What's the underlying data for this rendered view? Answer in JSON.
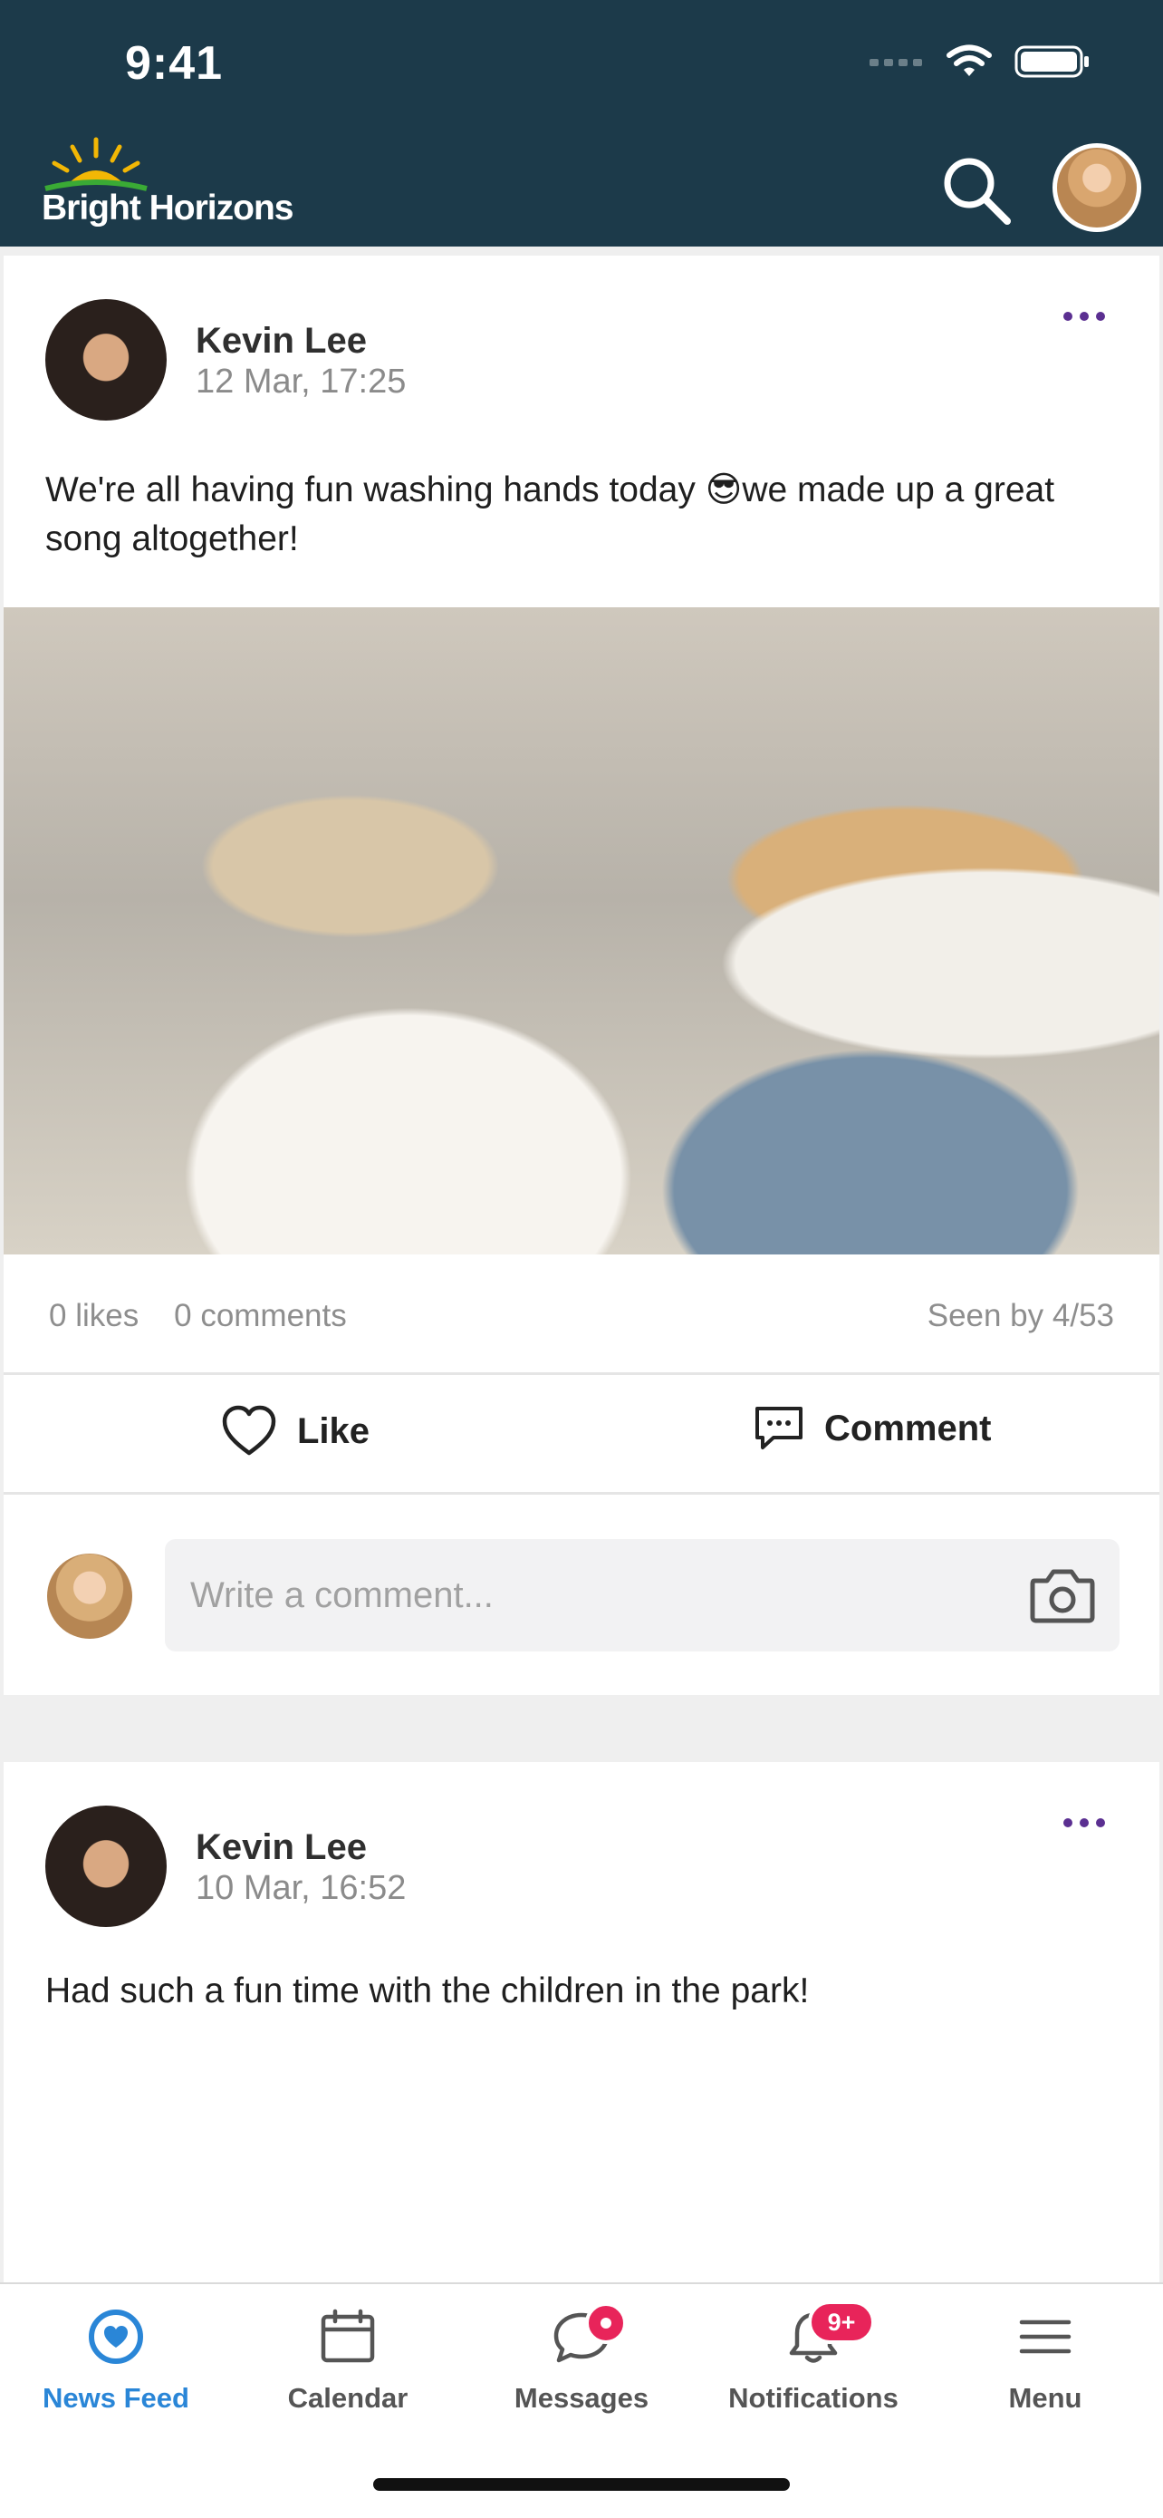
{
  "status": {
    "time": "9:41"
  },
  "brand": {
    "name": "Bright Horizons"
  },
  "posts": [
    {
      "author": "Kevin Lee",
      "time": "12 Mar, 17:25",
      "text": "We're all having fun washing hands today 😎we made up a great song altogether!",
      "likes": "0 likes",
      "comments": "0 comments",
      "seen": "Seen by 4/53",
      "like_label": "Like",
      "comment_label": "Comment",
      "comment_placeholder": "Write a comment..."
    },
    {
      "author": "Kevin Lee",
      "time": "10 Mar, 16:52",
      "text": "Had such a fun time with the children in the park!"
    }
  ],
  "tabs": [
    {
      "label": "News Feed",
      "icon": "heart-circle-icon",
      "active": true
    },
    {
      "label": "Calendar",
      "icon": "calendar-icon"
    },
    {
      "label": "Messages",
      "icon": "chat-bubble-icon"
    },
    {
      "label": "Notifications",
      "icon": "bell-icon",
      "badge": "9+"
    },
    {
      "label": "Menu",
      "icon": "hamburger-icon"
    }
  ],
  "colors": {
    "header_bg": "#1c3a4a",
    "accent_purple": "#5b2f91",
    "tab_active": "#2a86d7",
    "badge": "#e8245a"
  }
}
